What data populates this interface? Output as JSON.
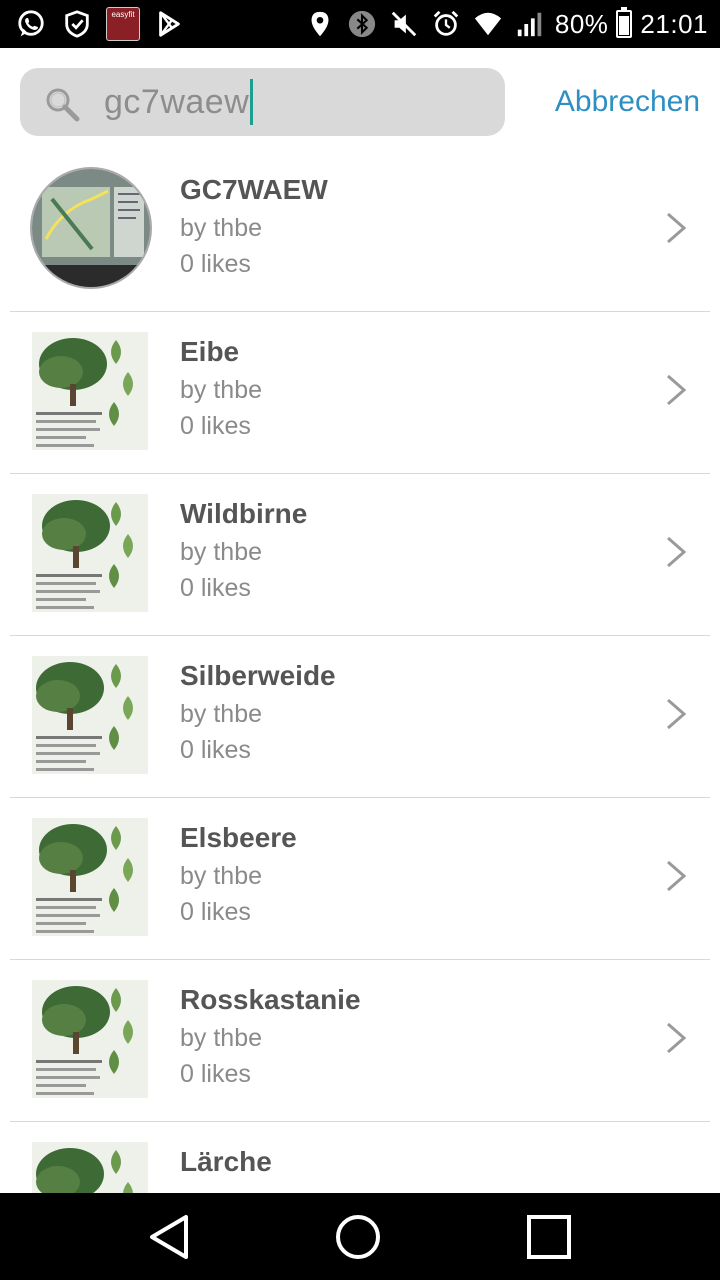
{
  "status_bar": {
    "easyfit_label": "easyfit",
    "battery_percent": "80%",
    "battery_level": 0.8,
    "time": "21:01",
    "icons": [
      "whatsapp-icon",
      "shield-check-icon",
      "easyfit-icon",
      "play-store-icon",
      "location-icon",
      "bluetooth-icon",
      "mute-icon",
      "alarm-icon",
      "wifi-icon",
      "signal-icon",
      "battery-icon"
    ]
  },
  "search": {
    "value": "gc7waew",
    "cancel_label": "Abbrechen",
    "icon": "search-icon"
  },
  "results": [
    {
      "title": "GC7WAEW",
      "by": "by thbe",
      "likes": "0 likes",
      "thumb": "map",
      "round": true
    },
    {
      "title": "Eibe",
      "by": "by thbe",
      "likes": "0 likes",
      "thumb": "tree",
      "round": false
    },
    {
      "title": "Wildbirne",
      "by": "by thbe",
      "likes": "0 likes",
      "thumb": "tree",
      "round": false
    },
    {
      "title": "Silberweide",
      "by": "by thbe",
      "likes": "0 likes",
      "thumb": "tree",
      "round": false
    },
    {
      "title": "Elsbeere",
      "by": "by thbe",
      "likes": "0 likes",
      "thumb": "tree",
      "round": false
    },
    {
      "title": "Rosskastanie",
      "by": "by thbe",
      "likes": "0 likes",
      "thumb": "tree",
      "round": false
    },
    {
      "title": "Lärche",
      "by": "",
      "likes": "",
      "thumb": "tree",
      "round": false
    }
  ],
  "nav_bar": {
    "buttons": [
      "back-icon",
      "home-icon",
      "recents-icon"
    ]
  },
  "colors": {
    "accent": "#2d8fc2",
    "caret": "#1e9e8e",
    "search_bg": "#d9d9d9",
    "title": "#555555",
    "subtext": "#8a8a8a"
  }
}
